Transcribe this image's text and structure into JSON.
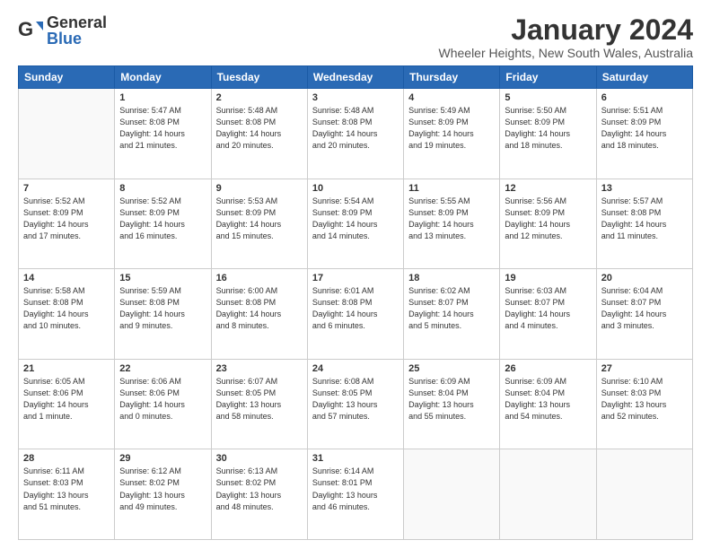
{
  "logo": {
    "general": "General",
    "blue": "Blue"
  },
  "title": "January 2024",
  "subtitle": "Wheeler Heights, New South Wales, Australia",
  "days_header": [
    "Sunday",
    "Monday",
    "Tuesday",
    "Wednesday",
    "Thursday",
    "Friday",
    "Saturday"
  ],
  "weeks": [
    [
      {
        "day": "",
        "info": ""
      },
      {
        "day": "1",
        "info": "Sunrise: 5:47 AM\nSunset: 8:08 PM\nDaylight: 14 hours\nand 21 minutes."
      },
      {
        "day": "2",
        "info": "Sunrise: 5:48 AM\nSunset: 8:08 PM\nDaylight: 14 hours\nand 20 minutes."
      },
      {
        "day": "3",
        "info": "Sunrise: 5:48 AM\nSunset: 8:08 PM\nDaylight: 14 hours\nand 20 minutes."
      },
      {
        "day": "4",
        "info": "Sunrise: 5:49 AM\nSunset: 8:09 PM\nDaylight: 14 hours\nand 19 minutes."
      },
      {
        "day": "5",
        "info": "Sunrise: 5:50 AM\nSunset: 8:09 PM\nDaylight: 14 hours\nand 18 minutes."
      },
      {
        "day": "6",
        "info": "Sunrise: 5:51 AM\nSunset: 8:09 PM\nDaylight: 14 hours\nand 18 minutes."
      }
    ],
    [
      {
        "day": "7",
        "info": "Sunrise: 5:52 AM\nSunset: 8:09 PM\nDaylight: 14 hours\nand 17 minutes."
      },
      {
        "day": "8",
        "info": "Sunrise: 5:52 AM\nSunset: 8:09 PM\nDaylight: 14 hours\nand 16 minutes."
      },
      {
        "day": "9",
        "info": "Sunrise: 5:53 AM\nSunset: 8:09 PM\nDaylight: 14 hours\nand 15 minutes."
      },
      {
        "day": "10",
        "info": "Sunrise: 5:54 AM\nSunset: 8:09 PM\nDaylight: 14 hours\nand 14 minutes."
      },
      {
        "day": "11",
        "info": "Sunrise: 5:55 AM\nSunset: 8:09 PM\nDaylight: 14 hours\nand 13 minutes."
      },
      {
        "day": "12",
        "info": "Sunrise: 5:56 AM\nSunset: 8:09 PM\nDaylight: 14 hours\nand 12 minutes."
      },
      {
        "day": "13",
        "info": "Sunrise: 5:57 AM\nSunset: 8:08 PM\nDaylight: 14 hours\nand 11 minutes."
      }
    ],
    [
      {
        "day": "14",
        "info": "Sunrise: 5:58 AM\nSunset: 8:08 PM\nDaylight: 14 hours\nand 10 minutes."
      },
      {
        "day": "15",
        "info": "Sunrise: 5:59 AM\nSunset: 8:08 PM\nDaylight: 14 hours\nand 9 minutes."
      },
      {
        "day": "16",
        "info": "Sunrise: 6:00 AM\nSunset: 8:08 PM\nDaylight: 14 hours\nand 8 minutes."
      },
      {
        "day": "17",
        "info": "Sunrise: 6:01 AM\nSunset: 8:08 PM\nDaylight: 14 hours\nand 6 minutes."
      },
      {
        "day": "18",
        "info": "Sunrise: 6:02 AM\nSunset: 8:07 PM\nDaylight: 14 hours\nand 5 minutes."
      },
      {
        "day": "19",
        "info": "Sunrise: 6:03 AM\nSunset: 8:07 PM\nDaylight: 14 hours\nand 4 minutes."
      },
      {
        "day": "20",
        "info": "Sunrise: 6:04 AM\nSunset: 8:07 PM\nDaylight: 14 hours\nand 3 minutes."
      }
    ],
    [
      {
        "day": "21",
        "info": "Sunrise: 6:05 AM\nSunset: 8:06 PM\nDaylight: 14 hours\nand 1 minute."
      },
      {
        "day": "22",
        "info": "Sunrise: 6:06 AM\nSunset: 8:06 PM\nDaylight: 14 hours\nand 0 minutes."
      },
      {
        "day": "23",
        "info": "Sunrise: 6:07 AM\nSunset: 8:05 PM\nDaylight: 13 hours\nand 58 minutes."
      },
      {
        "day": "24",
        "info": "Sunrise: 6:08 AM\nSunset: 8:05 PM\nDaylight: 13 hours\nand 57 minutes."
      },
      {
        "day": "25",
        "info": "Sunrise: 6:09 AM\nSunset: 8:04 PM\nDaylight: 13 hours\nand 55 minutes."
      },
      {
        "day": "26",
        "info": "Sunrise: 6:09 AM\nSunset: 8:04 PM\nDaylight: 13 hours\nand 54 minutes."
      },
      {
        "day": "27",
        "info": "Sunrise: 6:10 AM\nSunset: 8:03 PM\nDaylight: 13 hours\nand 52 minutes."
      }
    ],
    [
      {
        "day": "28",
        "info": "Sunrise: 6:11 AM\nSunset: 8:03 PM\nDaylight: 13 hours\nand 51 minutes."
      },
      {
        "day": "29",
        "info": "Sunrise: 6:12 AM\nSunset: 8:02 PM\nDaylight: 13 hours\nand 49 minutes."
      },
      {
        "day": "30",
        "info": "Sunrise: 6:13 AM\nSunset: 8:02 PM\nDaylight: 13 hours\nand 48 minutes."
      },
      {
        "day": "31",
        "info": "Sunrise: 6:14 AM\nSunset: 8:01 PM\nDaylight: 13 hours\nand 46 minutes."
      },
      {
        "day": "",
        "info": ""
      },
      {
        "day": "",
        "info": ""
      },
      {
        "day": "",
        "info": ""
      }
    ]
  ]
}
